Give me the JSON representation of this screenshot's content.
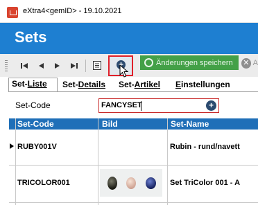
{
  "window": {
    "title": "eXtra4<gemID>  -  19.10.2021"
  },
  "header": {
    "title": "Sets"
  },
  "toolbar": {
    "save_label": "Änderungen speichern",
    "discard_label": "A"
  },
  "tabs": [
    {
      "label_u": "Set-",
      "label_rest": "Liste",
      "active": true
    },
    {
      "label_u": "Set-",
      "label_rest": "Details"
    },
    {
      "label_u": "Set-",
      "label_rest": "Artikel"
    },
    {
      "label_u": "E",
      "label_rest": "instellungen"
    }
  ],
  "filter": {
    "label": "Set-Code",
    "value": "FANCYSET"
  },
  "grid": {
    "columns": [
      "Set-Code",
      "Bild",
      "Set-Name"
    ],
    "rows": [
      {
        "code": "RUBY001V",
        "name": "Rubin - rund/navett",
        "selected": true
      },
      {
        "code": "TRICOLOR001",
        "name": "Set TriColor 001 - A"
      }
    ]
  },
  "colors": {
    "accent": "#1e7fd1",
    "grid_header": "#1f6fb8",
    "save": "#43a047",
    "highlight": "#e0202a"
  }
}
